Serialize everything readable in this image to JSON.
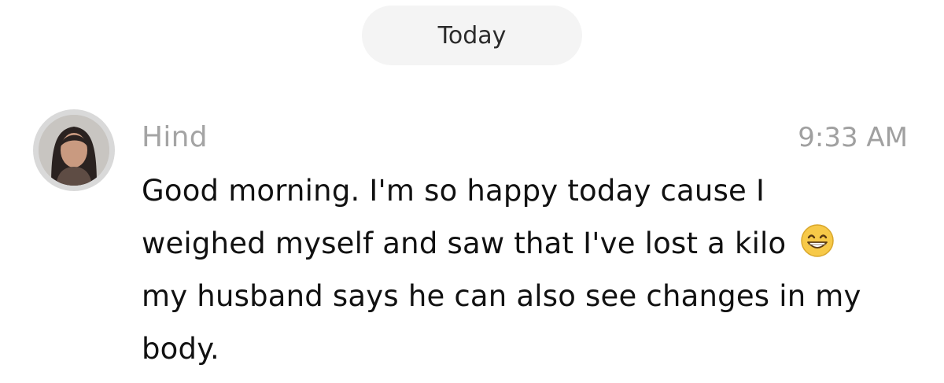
{
  "date_separator": "Today",
  "message": {
    "sender": "Hind",
    "time": "9:33 AM",
    "lines": [
      "Good morning. I'm so happy today cause I",
      "weighed myself and saw that I've lost a kilo",
      "my husband says he can also see changes in my",
      "body."
    ],
    "inline_emoji": "grinning-face-with-smiling-eyes"
  }
}
